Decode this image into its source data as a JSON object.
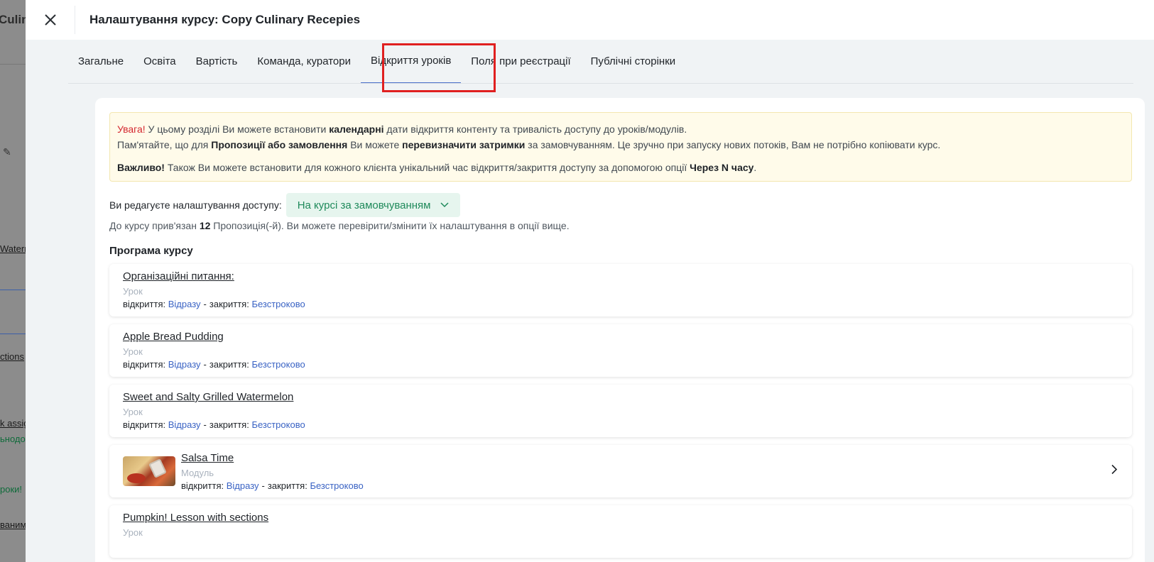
{
  "background_page": {
    "title_fragment": "Culina",
    "items": [
      "Waterm",
      "ctions",
      "k assig",
      "ьнодос",
      "роки!",
      "ваним"
    ]
  },
  "drawer": {
    "title": "Налаштування курсу: Copy Culinary Recepies",
    "close_icon": "close-icon"
  },
  "tabs": [
    {
      "label": "Загальне"
    },
    {
      "label": "Освіта"
    },
    {
      "label": "Вартість"
    },
    {
      "label": "Команда, куратори"
    },
    {
      "label": "Відкриття уроків",
      "active": true
    },
    {
      "label": "Поля при реєстрації"
    },
    {
      "label": "Публічні сторінки"
    }
  ],
  "notice": {
    "warn": "Увага!",
    "line1_a": " У цьому розділі Ви можете встановити ",
    "line1_b": "календарні",
    "line1_c": " дати відкриття контенту та тривалість доступу до уроків/модулів.",
    "line2_a": "Пам'ятайте, що для ",
    "line2_b": "Пропозиції або замовлення",
    "line2_c": " Ви можете ",
    "line2_d": "перевизначити затримки",
    "line2_e": " за замовчуванням. Це зручно при запуску нових потоків, Вам не потрібно копіювати курс.",
    "line3_a": "Важливо!",
    "line3_b": " Також Ви можете встановити для кожного клієнта унікальний час відкриття/закриття доступу за допомогою опції ",
    "line3_c": "Через N часу",
    "line3_d": "."
  },
  "access": {
    "label": "Ви редагуєте налаштування доступу:",
    "selected": "На курсі за замовчуванням",
    "chevron_icon": "chevron-down-icon"
  },
  "bound": {
    "prefix": "До курсу прив'язан ",
    "count": "12",
    "suffix": " Пропозиція(-й). Ви можете перевірити/змінити їх налаштування в опції вище."
  },
  "program": {
    "title": "Програма курсу",
    "open_label": "відкриття:",
    "close_label": "закриття:",
    "separator": "-",
    "items": [
      {
        "title": "Організаційні питання:",
        "type": "Урок",
        "open": "Відразу",
        "close": "Безстроково"
      },
      {
        "title": "Apple Bread Pudding",
        "type": "Урок",
        "open": "Відразу",
        "close": "Безстроково"
      },
      {
        "title": "Sweet and Salty Grilled Watermelon",
        "type": "Урок",
        "open": "Відразу",
        "close": "Безстроково"
      },
      {
        "title": "Salsa Time",
        "type": "Модуль",
        "open": "Відразу",
        "close": "Безстроково"
      },
      {
        "title": "Pumpkin! Lesson with sections",
        "type": "Урок"
      }
    ]
  },
  "colors": {
    "highlight": "#e02020",
    "link": "#3a63c4",
    "select_bg": "#e6f5ee",
    "select_text": "#1f8a5b",
    "warning": "#d4272f"
  }
}
